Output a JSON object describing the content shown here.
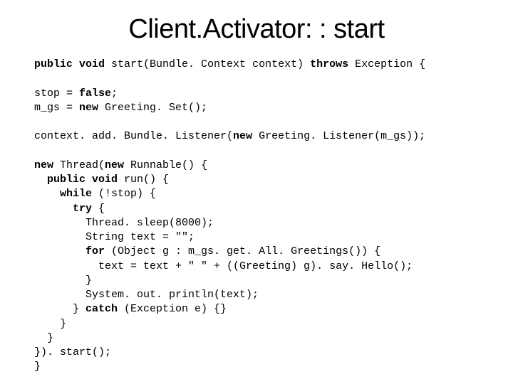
{
  "title": "Client.Activator: : start",
  "code": {
    "l1a": "public void",
    "l1b": " start(Bundle. Context context) ",
    "l1c": "throws",
    "l1d": " Exception {",
    "l2a": "stop = ",
    "l2b": "false",
    "l2c": ";",
    "l3a": "m_gs = ",
    "l3b": "new",
    "l3c": " Greeting. Set();",
    "l4a": "context. add. Bundle. Listener(",
    "l4b": "new",
    "l4c": " Greeting. Listener(m_gs));",
    "l5a": "new",
    "l5b": " Thread(",
    "l5c": "new",
    "l5d": " Runnable() {",
    "l6a": "  ",
    "l6b": "public void",
    "l6c": " run() {",
    "l7a": "    ",
    "l7b": "while",
    "l7c": " (!stop) {",
    "l8a": "      ",
    "l8b": "try",
    "l8c": " {",
    "l9": "        Thread. sleep(8000);",
    "l10": "        String text = \"\";",
    "l11a": "        ",
    "l11b": "for",
    "l11c": " (Object g : m_gs. get. All. Greetings()) {",
    "l12": "          text = text + \" \" + ((Greeting) g). say. Hello();",
    "l13": "        }",
    "l14": "        System. out. println(text);",
    "l15a": "      } ",
    "l15b": "catch",
    "l15c": " (Exception e) {}",
    "l16": "    }",
    "l17": "  }",
    "l18": "}). start();",
    "l19": "}"
  }
}
